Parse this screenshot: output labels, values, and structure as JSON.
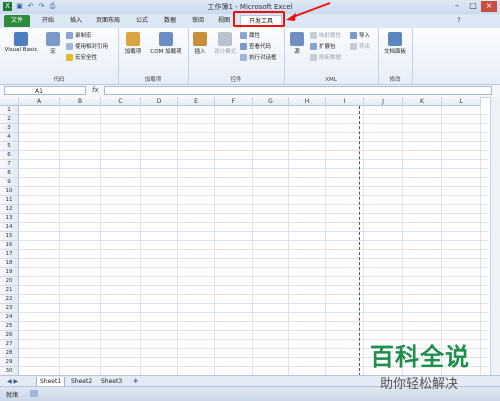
{
  "window": {
    "title": "工作簿1 - Microsoft Excel",
    "quick_access": [
      "save-icon",
      "undo-icon",
      "redo-icon",
      "print-preview-icon"
    ],
    "controls": [
      "minimize",
      "maximize",
      "close"
    ]
  },
  "tabs": [
    "文件",
    "开始",
    "插入",
    "页面布局",
    "公式",
    "数据",
    "视图",
    "审阅",
    "开发工具"
  ],
  "ribbon": {
    "groups": [
      {
        "label": "代码",
        "items": [
          "Visual Basic",
          "宏",
          "录制宏",
          "使用相对引用",
          "宏安全性"
        ]
      },
      {
        "label": "加载项",
        "items": [
          "加载项",
          "COM 加载项"
        ]
      },
      {
        "label": "控件",
        "items": [
          "插入",
          "设计模式",
          "属性",
          "查看代码",
          "执行对话框"
        ]
      },
      {
        "label": "XML",
        "items": [
          "源",
          "映射属性",
          "扩展包",
          "刷新数据",
          "导入",
          "导出"
        ]
      },
      {
        "label": "修改",
        "items": [
          "文档面板"
        ]
      }
    ]
  },
  "formula_bar": {
    "name_box": "A1",
    "fx": "fx",
    "value": ""
  },
  "grid": {
    "columns": [
      "A",
      "B",
      "C",
      "D",
      "E",
      "F",
      "G",
      "H",
      "I",
      "J",
      "K",
      "L"
    ],
    "rows": [
      "1",
      "2",
      "3",
      "4",
      "5",
      "6",
      "7",
      "8",
      "9",
      "10",
      "11",
      "12",
      "13",
      "14",
      "15",
      "16",
      "17",
      "18",
      "19",
      "20",
      "21",
      "22",
      "23",
      "24",
      "25",
      "26",
      "27",
      "28",
      "29",
      "30"
    ]
  },
  "sheets": [
    "Sheet1",
    "Sheet2",
    "Sheet3"
  ],
  "status": {
    "ready": "就绪"
  },
  "watermark": {
    "main": "百科全说",
    "sub": "助你轻松解决"
  }
}
